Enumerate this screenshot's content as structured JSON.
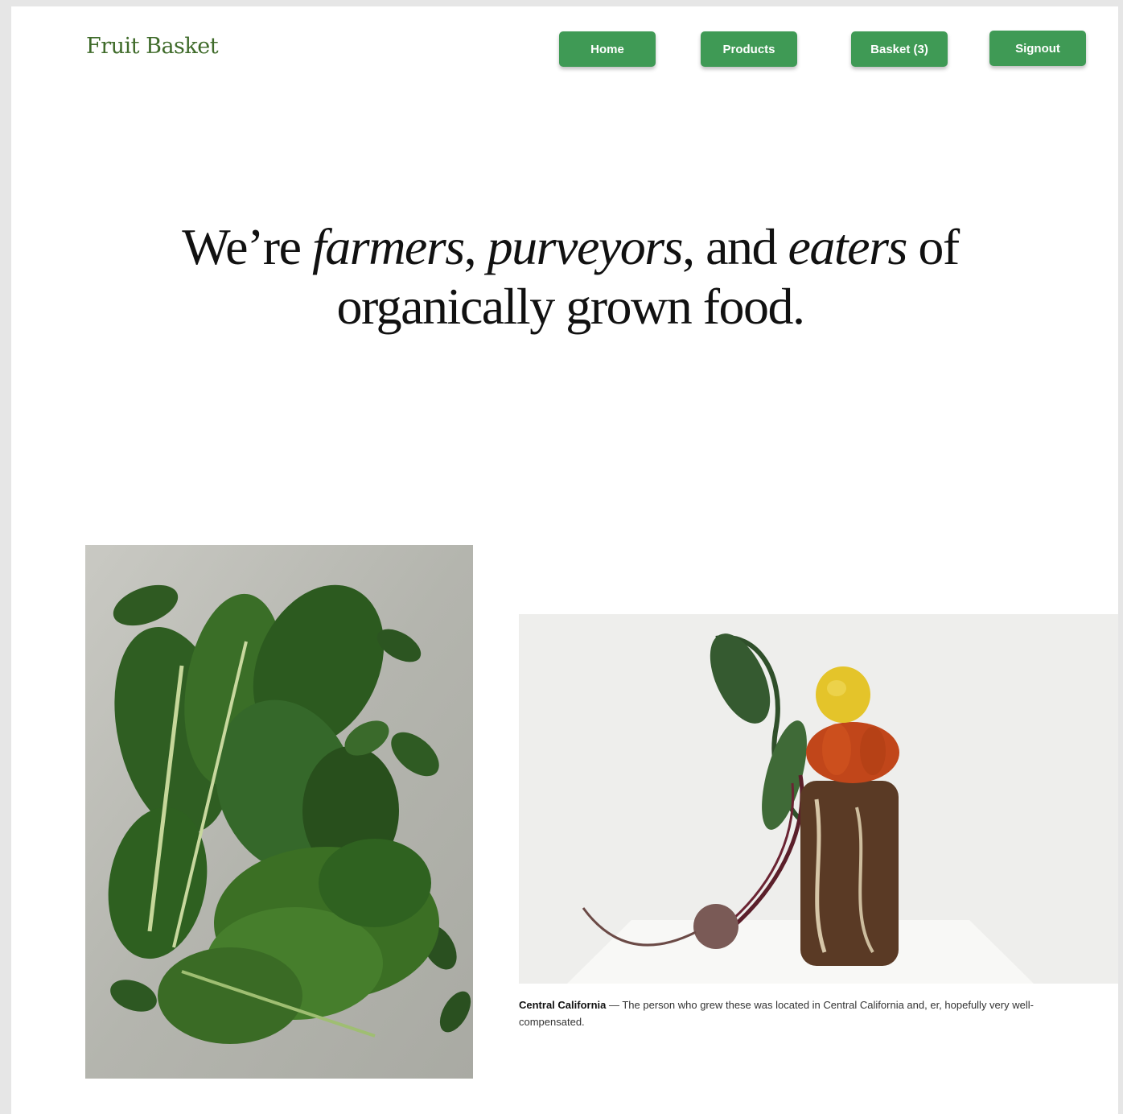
{
  "header": {
    "brand": "Fruit Basket",
    "nav": {
      "home": "Home",
      "products": "Products",
      "basket": "Basket (3)",
      "signout": "Signout"
    }
  },
  "hero": {
    "part1": "We’re ",
    "em1": "farmers",
    "part2": ", ",
    "em2": "purveyors",
    "part3": ", and ",
    "em3": "eaters",
    "part4": " of organically grown food."
  },
  "caption": {
    "title": "Central California",
    "separator": " — ",
    "text": "The person who grew these was located in Central California and, er, hopefully very well-compensated."
  },
  "colors": {
    "brand": "#3f6b2a",
    "button": "#3f9a55"
  }
}
